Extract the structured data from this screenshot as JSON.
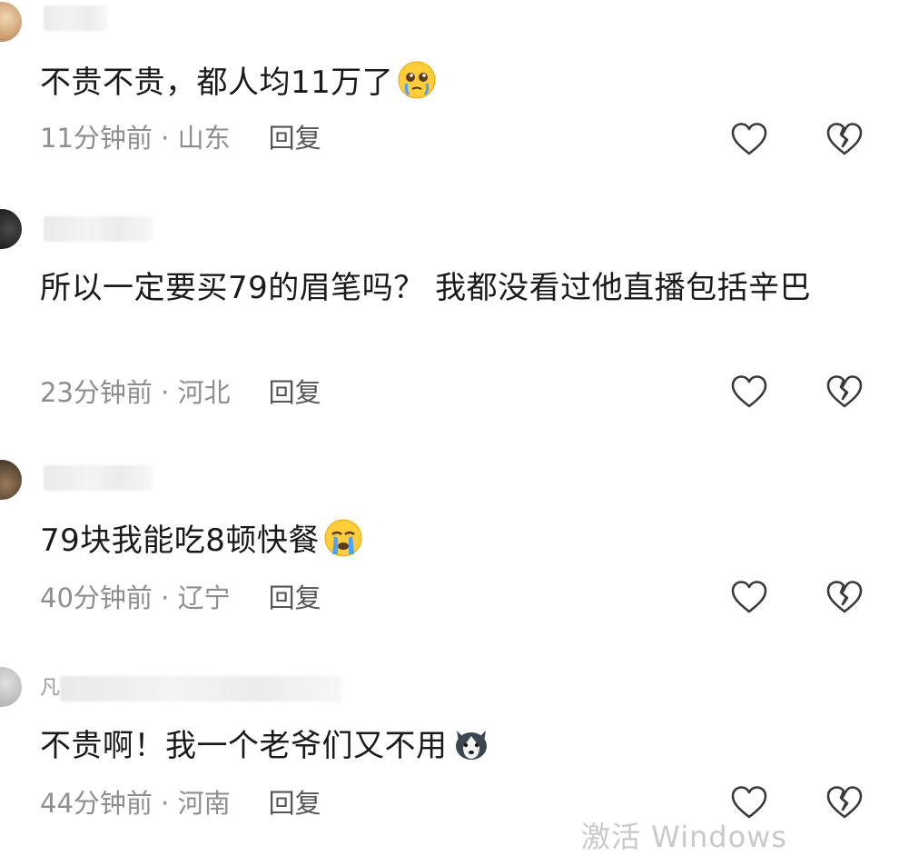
{
  "comments": [
    {
      "text": "不贵不贵，都人均11万了",
      "emoji": "pleading-tears-emoji",
      "time": "11分钟前",
      "location": "山东",
      "reply_label": "回复"
    },
    {
      "text": "所以一定要买79的眉笔吗？  我都没看过他直播包括辛巴",
      "emoji": "",
      "time": "23分钟前",
      "location": "河北",
      "reply_label": "回复"
    },
    {
      "text": "79块我能吃8顿快餐",
      "emoji": "crying-face-emoji",
      "time": "40分钟前",
      "location": "辽宁",
      "reply_label": "回复"
    },
    {
      "text": "不贵啊！我一个老爷们又不用",
      "emoji": "husky-dog-emoji",
      "username_initial": "凡",
      "time": "44分钟前",
      "location": "河南",
      "reply_label": "回复"
    }
  ],
  "separator": " · ",
  "watermark": "激活 Windows",
  "colors": {
    "text": "#1a1a1a",
    "meta": "#8e8e8e",
    "icon_stroke": "#3a3a3a"
  }
}
